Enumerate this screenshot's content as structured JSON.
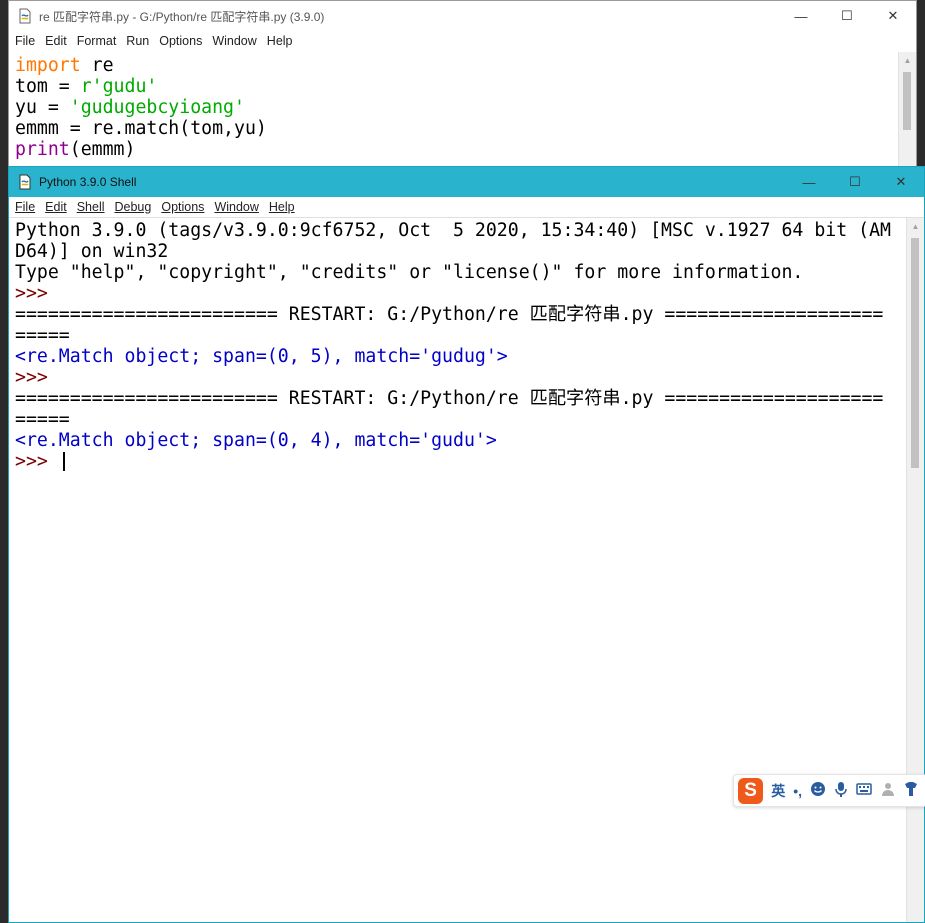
{
  "editor": {
    "title": "re 匹配字符串.py - G:/Python/re 匹配字符串.py (3.9.0)",
    "menu": [
      "File",
      "Edit",
      "Format",
      "Run",
      "Options",
      "Window",
      "Help"
    ],
    "lines": [
      {
        "kw": "import",
        "rest": " re"
      },
      {
        "pre": "tom = ",
        "str": "r'gudu'"
      },
      {
        "pre": "yu = ",
        "str": "'gudugebcyioang'"
      },
      {
        "plain": "emmm = re.match(tom,yu)"
      },
      {
        "bi": "print",
        "rest": "(emmm)"
      }
    ],
    "controls": {
      "minimize": "—",
      "maximize": "☐",
      "close": "✕"
    }
  },
  "shell": {
    "title": "Python 3.9.0 Shell",
    "menu": [
      "File",
      "Edit",
      "Shell",
      "Debug",
      "Options",
      "Window",
      "Help"
    ],
    "banner_line1": "Python 3.9.0 (tags/v3.9.0:9cf6752, Oct  5 2020, 15:34:40) [MSC v.1927 64 bit (AM",
    "banner_line2": "D64)] on win32",
    "banner_line3": "Type \"help\", \"copyright\", \"credits\" or \"license()\" for more information.",
    "prompt": ">>> ",
    "restart_line1": "======================== RESTART: G:/Python/re 匹配字符串.py ====================",
    "restart_line2": "=====",
    "result1": "<re.Match object; span=(0, 5), match='gudug'>",
    "result2": "<re.Match object; span=(0, 4), match='gudu'>",
    "controls": {
      "minimize": "—",
      "maximize": "☐",
      "close": "✕"
    }
  },
  "ime_toolbar": {
    "logo": "S",
    "mode": "英",
    "punct": "•,",
    "icons": [
      "emoji-icon",
      "microphone-icon",
      "keyboard-icon",
      "user-icon",
      "shirt-icon"
    ]
  },
  "colors": {
    "keyword": "#ff7700",
    "string": "#00aa00",
    "builtin": "#900090",
    "prompt": "#7a0000",
    "result": "#0000c8",
    "shell_titlebar": "#29b3cc"
  }
}
